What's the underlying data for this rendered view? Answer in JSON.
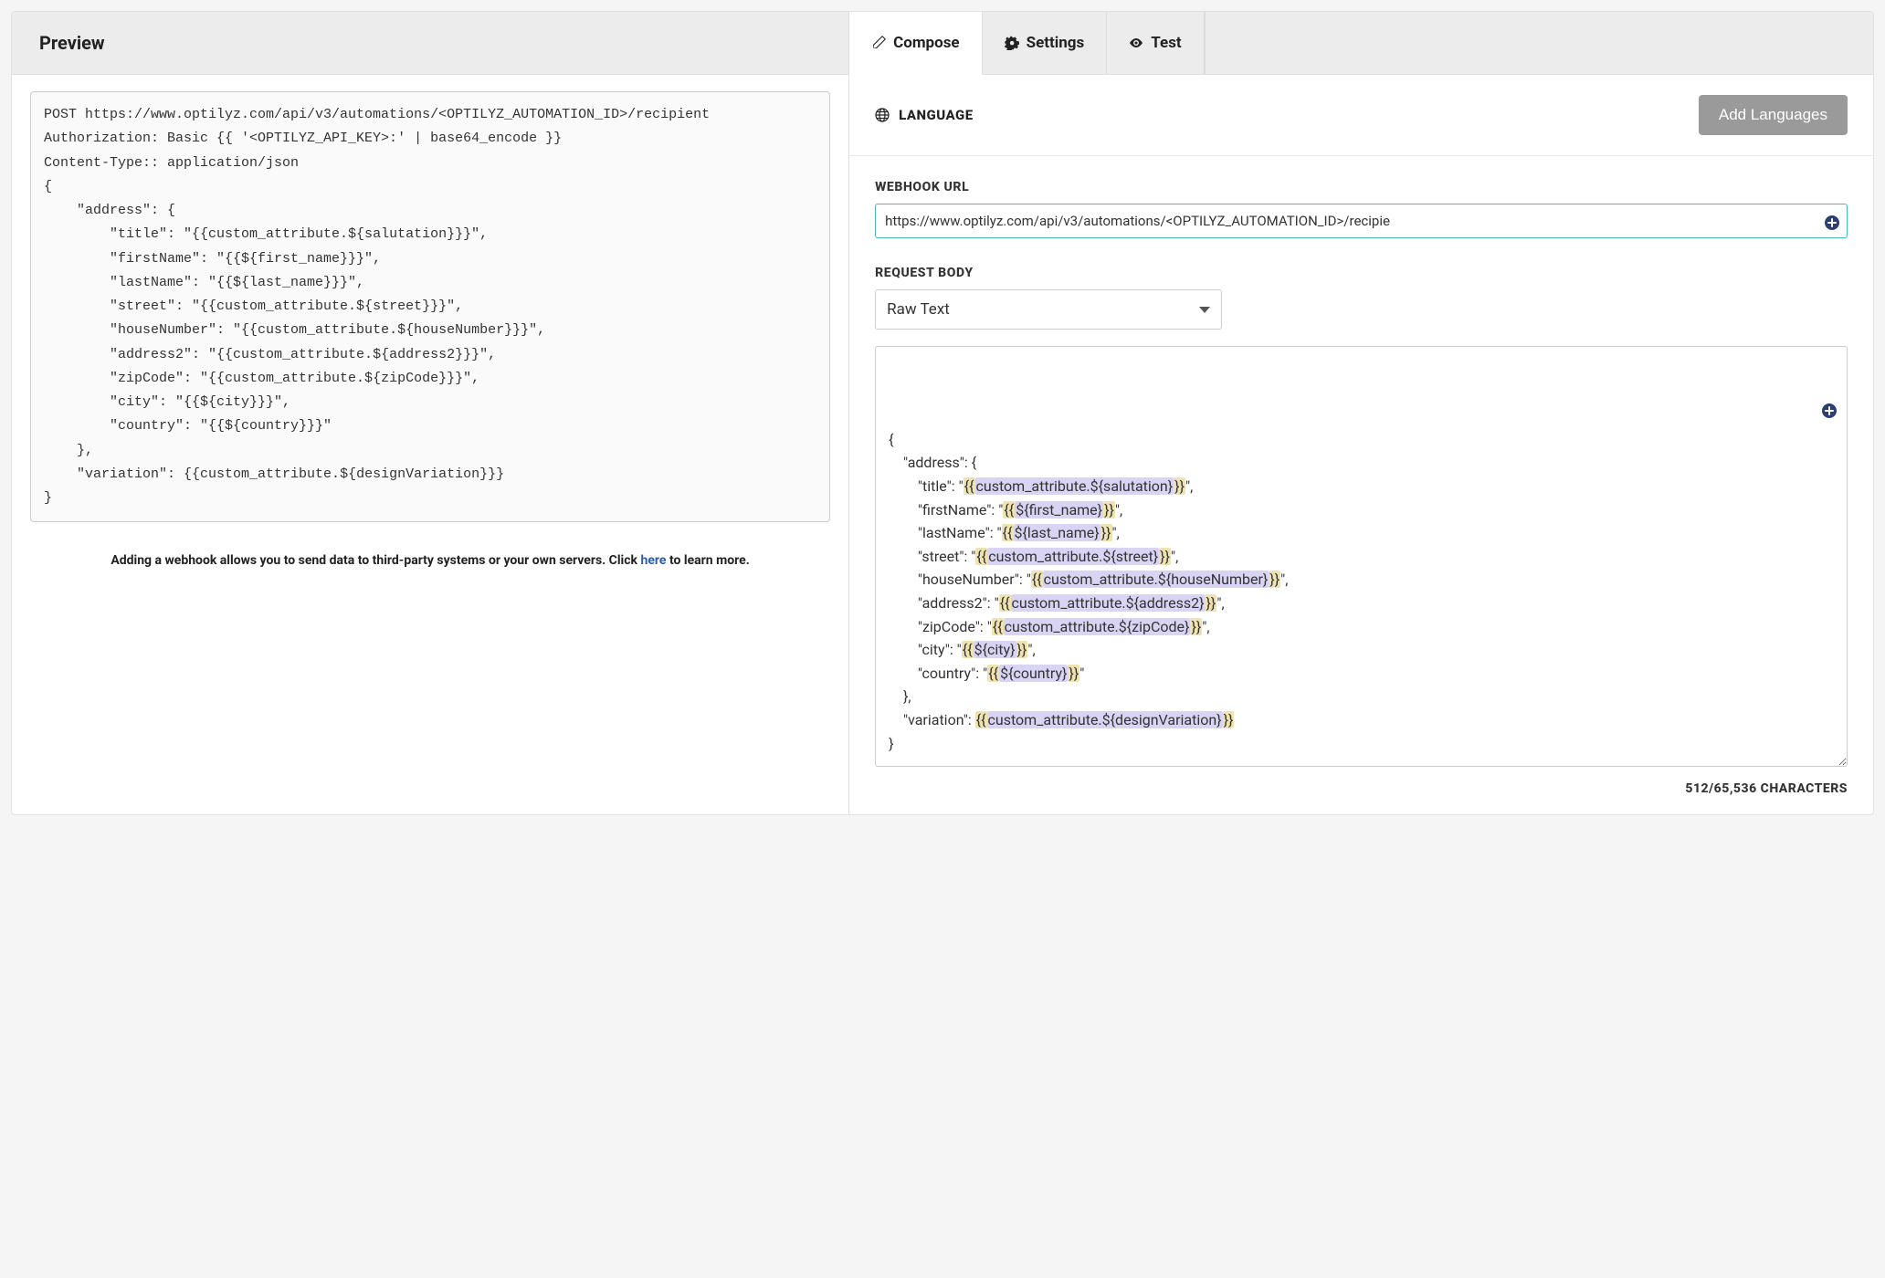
{
  "preview": {
    "title": "Preview",
    "content": "POST https://www.optilyz.com/api/v3/automations/<OPTILYZ_AUTOMATION_ID>/recipient\nAuthorization: Basic {{ '<OPTILYZ_API_KEY>:' | base64_encode }}\nContent-Type:: application/json\n{\n    \"address\": {\n        \"title\": \"{{custom_attribute.${salutation}}}\",\n        \"firstName\": \"{{${first_name}}}\",\n        \"lastName\": \"{{${last_name}}}\",\n        \"street\": \"{{custom_attribute.${street}}}\",\n        \"houseNumber\": \"{{custom_attribute.${houseNumber}}}\",\n        \"address2\": \"{{custom_attribute.${address2}}}\",\n        \"zipCode\": \"{{custom_attribute.${zipCode}}}\",\n        \"city\": \"{{${city}}}\",\n        \"country\": \"{{${country}}}\"\n    },\n    \"variation\": {{custom_attribute.${designVariation}}}\n}",
    "note_prefix": "Adding a webhook allows you to send data to third-party systems or your own servers. Click ",
    "note_link": "here",
    "note_suffix": " to learn more."
  },
  "tabs": {
    "compose": "Compose",
    "settings": "Settings",
    "test": "Test"
  },
  "language": {
    "label": "LANGUAGE",
    "button": "Add Languages"
  },
  "webhook": {
    "label": "WEBHOOK URL",
    "value": "https://www.optilyz.com/api/v3/automations/<OPTILYZ_AUTOMATION_ID>/recipie"
  },
  "request_body": {
    "label": "REQUEST BODY",
    "dropdown": "Raw Text",
    "lines": [
      {
        "indent": 0,
        "pre": "{",
        "tok": null,
        "post": ""
      },
      {
        "indent": 1,
        "pre": "\"address\": {",
        "tok": null,
        "post": ""
      },
      {
        "indent": 2,
        "pre": "\"title\": \"",
        "tok": "{{custom_attribute.${salutation}}}",
        "post": "\","
      },
      {
        "indent": 2,
        "pre": "\"firstName\": \"",
        "tok": "{{${first_name}}}",
        "post": "\","
      },
      {
        "indent": 2,
        "pre": "\"lastName\": \"",
        "tok": "{{${last_name}}}",
        "post": "\","
      },
      {
        "indent": 2,
        "pre": "\"street\": \"",
        "tok": "{{custom_attribute.${street}}}",
        "post": "\","
      },
      {
        "indent": 2,
        "pre": "\"houseNumber\": \"",
        "tok": "{{custom_attribute.${houseNumber}}}",
        "post": "\","
      },
      {
        "indent": 2,
        "pre": "\"address2\": \"",
        "tok": "{{custom_attribute.${address2}}}",
        "post": "\","
      },
      {
        "indent": 2,
        "pre": "\"zipCode\": \"",
        "tok": "{{custom_attribute.${zipCode}}}",
        "post": "\","
      },
      {
        "indent": 2,
        "pre": "\"city\": \"",
        "tok": "{{${city}}}",
        "post": "\","
      },
      {
        "indent": 2,
        "pre": "\"country\": \"",
        "tok": "{{${country}}}",
        "post": "\""
      },
      {
        "indent": 1,
        "pre": "},",
        "tok": null,
        "post": ""
      },
      {
        "indent": 1,
        "pre": "\"variation\": ",
        "tok": "{{custom_attribute.${designVariation}}}",
        "post": ""
      },
      {
        "indent": 0,
        "pre": "}",
        "tok": null,
        "post": ""
      }
    ],
    "char_count": "512/65,536 CHARACTERS"
  }
}
